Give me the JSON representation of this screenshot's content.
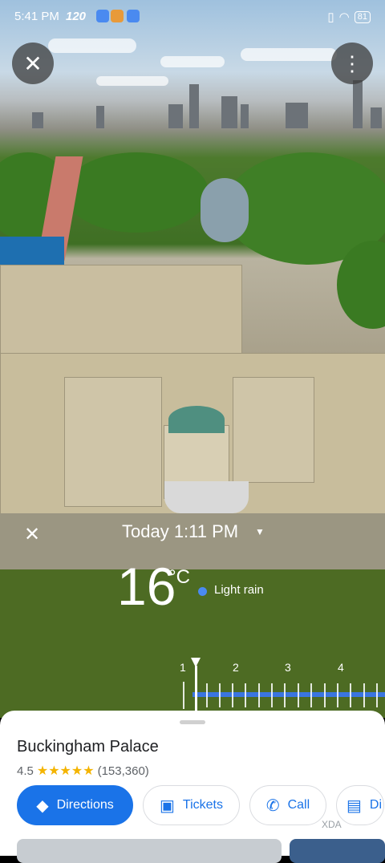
{
  "status_bar": {
    "time": "5:41 PM",
    "extra": "120",
    "battery": "81"
  },
  "place": {
    "name": "Buckingham Palace",
    "rating": "4.5",
    "stars": "★★★★★",
    "review_count": "(153,360)"
  },
  "weather": {
    "close_label": "✕",
    "time_label": "Today 1:11 PM",
    "temperature": "16",
    "unit": "°C",
    "condition": "Light rain"
  },
  "timeline": {
    "labels": [
      "1",
      "2",
      "3",
      "4"
    ]
  },
  "actions": [
    {
      "label": "Directions",
      "icon": "directions-icon"
    },
    {
      "label": "Tickets",
      "icon": "tickets-icon"
    },
    {
      "label": "Call",
      "icon": "phone-icon"
    },
    {
      "label": "Di",
      "icon": "store-icon"
    }
  ],
  "watermark": "XDA",
  "colors": {
    "accent": "#1a73e8",
    "star": "#f4b400",
    "rain_dot": "#4a8af0"
  }
}
